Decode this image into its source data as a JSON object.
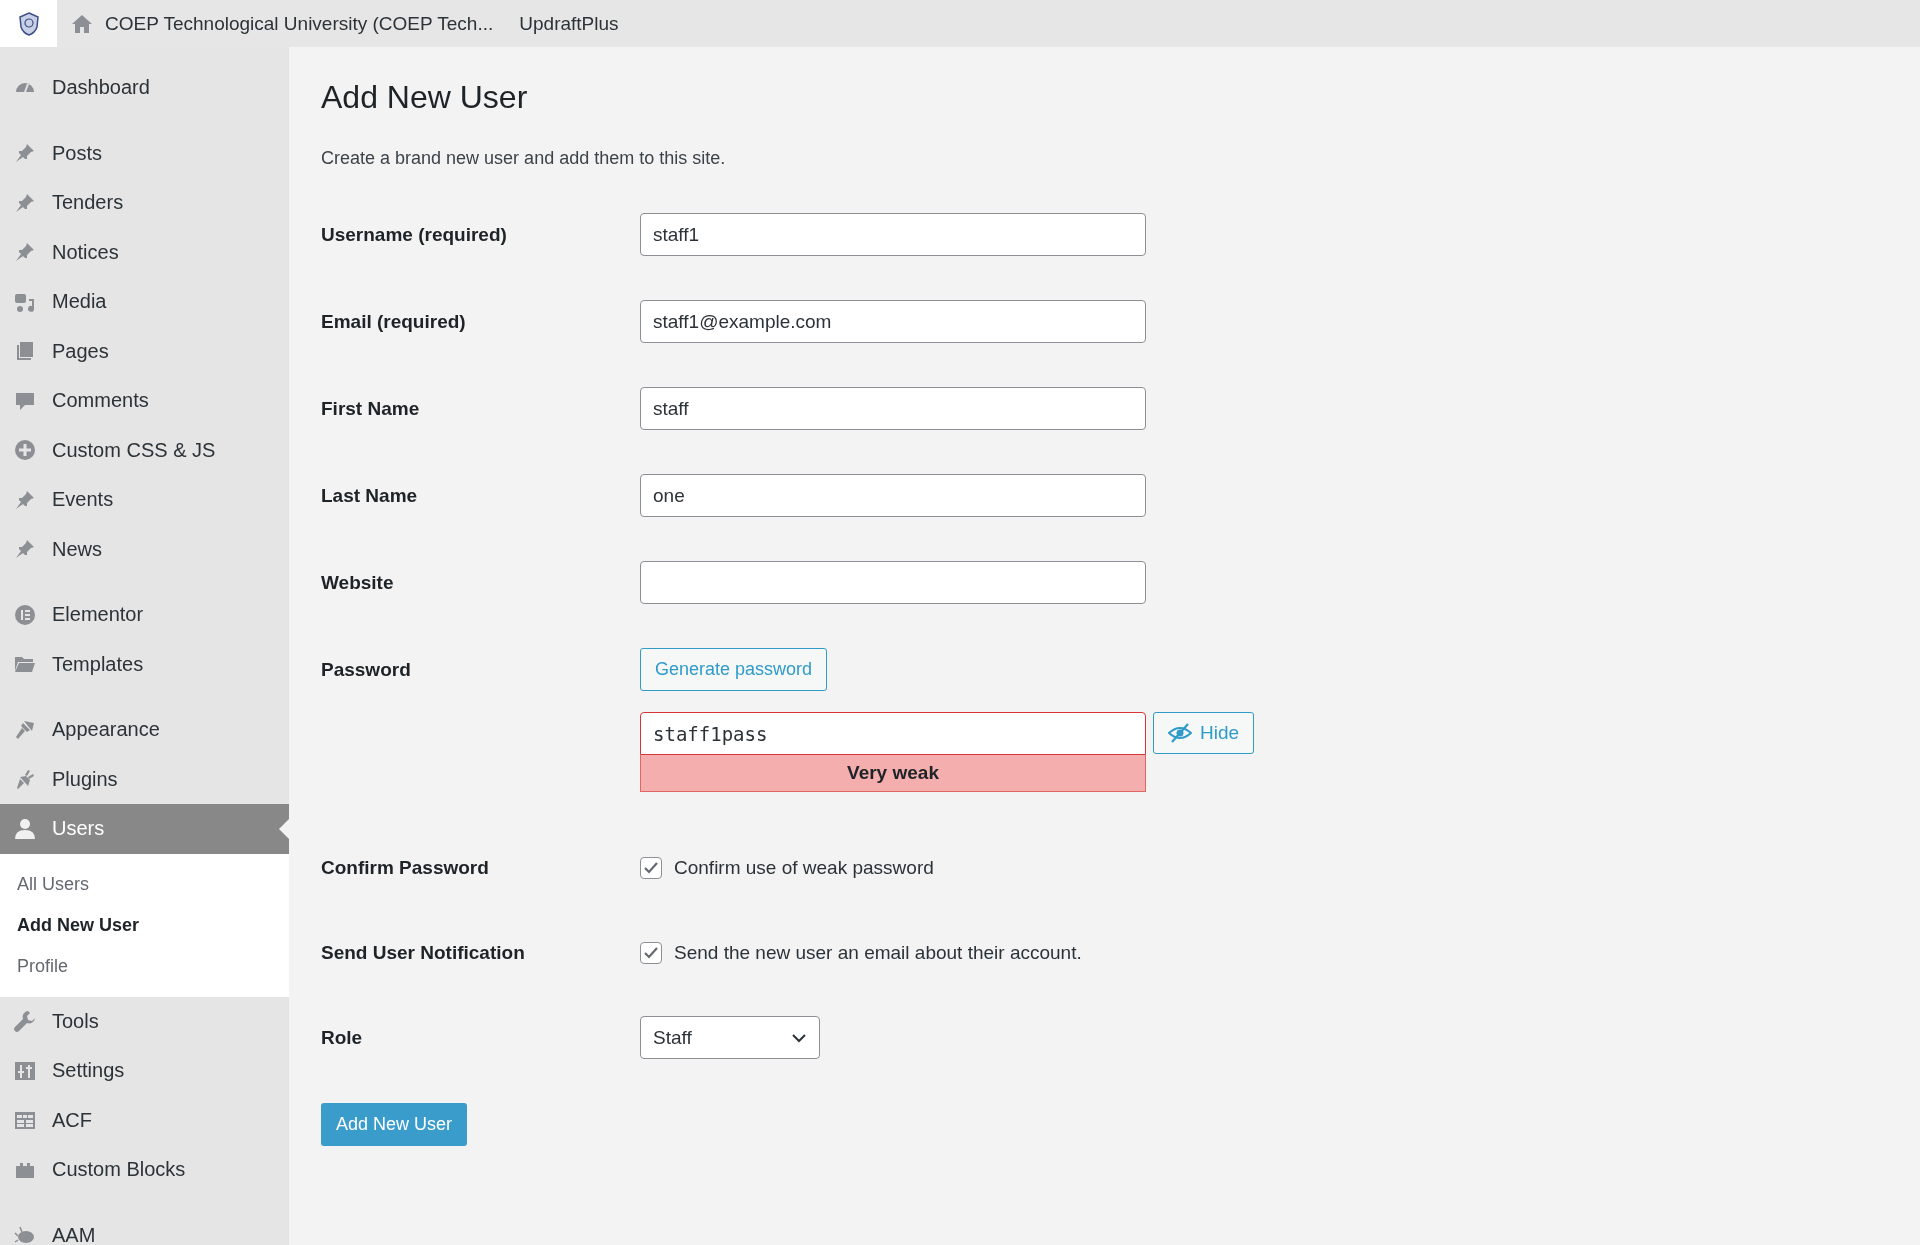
{
  "topbar": {
    "site_name": "COEP Technological University (COEP Tech...",
    "plugin_link": "UpdraftPlus"
  },
  "sidebar": {
    "groups": [
      [
        {
          "label": "Dashboard",
          "selected": false
        }
      ],
      [
        {
          "label": "Posts",
          "selected": false
        },
        {
          "label": "Tenders",
          "selected": false
        },
        {
          "label": "Notices",
          "selected": false
        },
        {
          "label": "Media",
          "selected": false
        },
        {
          "label": "Pages",
          "selected": false
        },
        {
          "label": "Comments",
          "selected": false
        },
        {
          "label": "Custom CSS & JS",
          "selected": false
        },
        {
          "label": "Events",
          "selected": false
        },
        {
          "label": "News",
          "selected": false
        }
      ],
      [
        {
          "label": "Elementor",
          "selected": false
        },
        {
          "label": "Templates",
          "selected": false
        }
      ],
      [
        {
          "label": "Appearance",
          "selected": false
        },
        {
          "label": "Plugins",
          "selected": false
        },
        {
          "label": "Users",
          "selected": true,
          "children": [
            {
              "label": "All Users",
              "selected": false
            },
            {
              "label": "Add New User",
              "selected": true
            },
            {
              "label": "Profile",
              "selected": false
            }
          ]
        },
        {
          "label": "Tools",
          "selected": false
        },
        {
          "label": "Settings",
          "selected": false
        },
        {
          "label": "ACF",
          "selected": false
        },
        {
          "label": "Custom Blocks",
          "selected": false
        }
      ],
      [
        {
          "label": "AAM",
          "selected": false
        }
      ]
    ]
  },
  "page": {
    "title": "Add New User",
    "description": "Create a brand new user and add them to this site.",
    "fields": [
      {
        "label": "Username (required)",
        "value": "staff1"
      },
      {
        "label": "Email (required)",
        "value": "staff1@example.com"
      },
      {
        "label": "First Name",
        "value": "staff"
      },
      {
        "label": "Last Name",
        "value": "one"
      },
      {
        "label": "Website"
      }
    ],
    "password": {
      "label": "Password",
      "generate_button": "Generate password",
      "value": "staff1pass",
      "hide_button": "Hide",
      "strength": "Very weak"
    },
    "checks": [
      {
        "label": "Confirm Password",
        "text": "Confirm use of weak password",
        "checked": true
      },
      {
        "label": "Send User Notification",
        "text": "Send the new user an email about their account.",
        "checked": true
      }
    ],
    "role": {
      "label": "Role",
      "value": "Staff"
    },
    "submit": "Add New User"
  }
}
